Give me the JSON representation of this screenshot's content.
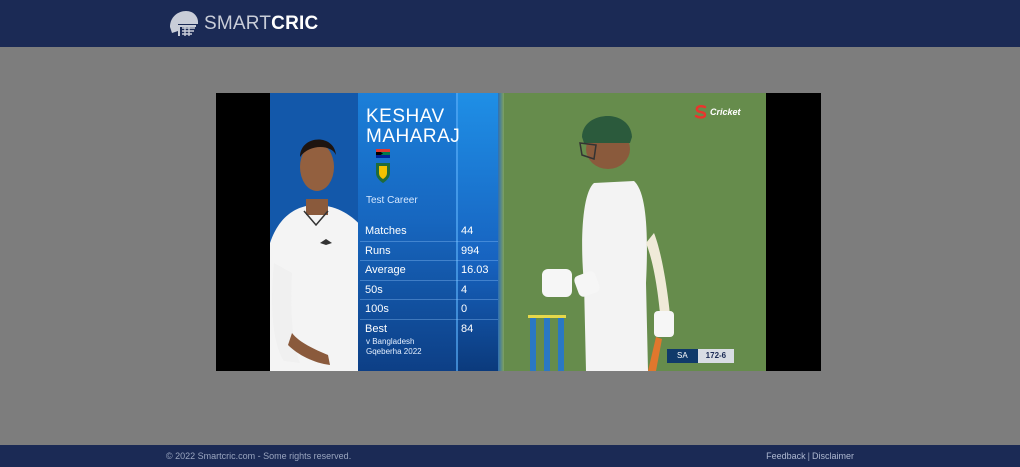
{
  "header": {
    "brand_light": "SMART",
    "brand_bold": "CRIC",
    "logo_icon": "cricket-helmet-icon"
  },
  "video": {
    "player": {
      "first_name": "KESHAV",
      "last_name": "MAHARAJ",
      "subtitle": "Test Career"
    },
    "stats": [
      {
        "label": "Matches",
        "value": "44"
      },
      {
        "label": "Runs",
        "value": "994"
      },
      {
        "label": "Average",
        "value": "16.03"
      },
      {
        "label": "50s",
        "value": "4"
      },
      {
        "label": "100s",
        "value": "0"
      },
      {
        "label": "Best",
        "value": "84"
      }
    ],
    "best_detail_line1": "v Bangladesh",
    "best_detail_line2": "Gqeberha 2022",
    "broadcaster": "Cricket",
    "score_team": "SA",
    "score_runs": "172-6"
  },
  "footer": {
    "copyright": "© 2022 Smartcric.com - Some rights reserved.",
    "link_feedback": "Feedback",
    "separator": "|",
    "link_disclaimer": "Disclaimer"
  },
  "colors": {
    "header_bg": "#1b2a55",
    "page_bg": "#7d7d7d",
    "graphic_blue": "#1767c0"
  }
}
